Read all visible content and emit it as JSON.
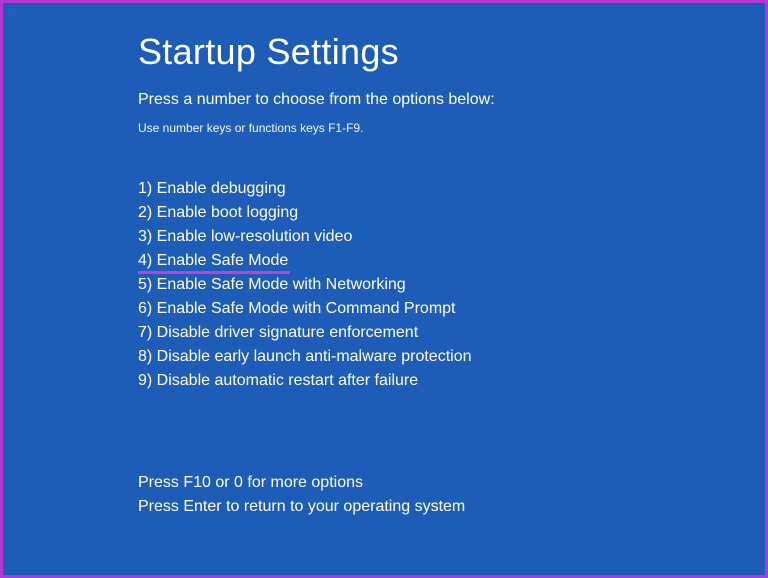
{
  "title": "Startup Settings",
  "subtitle": "Press a number to choose from the options below:",
  "hint": "Use number keys or functions keys F1-F9.",
  "options": [
    {
      "label": "1) Enable debugging",
      "highlighted": false
    },
    {
      "label": "2) Enable boot logging",
      "highlighted": false
    },
    {
      "label": "3) Enable low-resolution video",
      "highlighted": false
    },
    {
      "label": "4) Enable Safe Mode",
      "highlighted": true
    },
    {
      "label": "5) Enable Safe Mode with Networking",
      "highlighted": false
    },
    {
      "label": "6) Enable Safe Mode with Command Prompt",
      "highlighted": false
    },
    {
      "label": "7) Disable driver signature enforcement",
      "highlighted": false
    },
    {
      "label": "8) Disable early launch anti-malware protection",
      "highlighted": false
    },
    {
      "label": "9) Disable automatic restart after failure",
      "highlighted": false
    }
  ],
  "footer": {
    "more_options": "Press F10 or 0 for more options",
    "return": "Press Enter to return to your operating system"
  },
  "colors": {
    "background": "#1e5db7",
    "border": "#b835d8",
    "highlight": "#c13fd6",
    "text": "#ffffff"
  }
}
